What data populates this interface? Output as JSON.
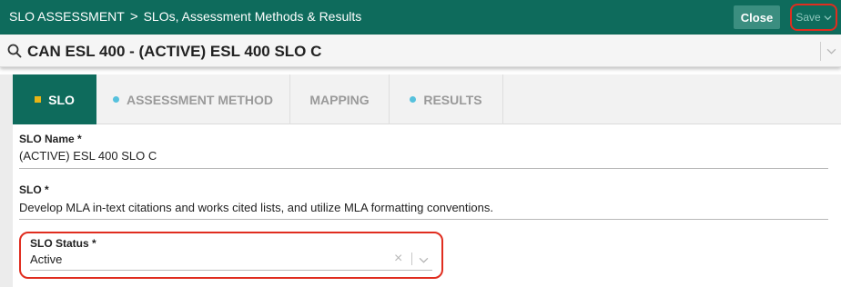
{
  "header": {
    "crumb_root": "SLO ASSESSMENT",
    "crumb_separator": ">",
    "crumb_page": "SLOs, Assessment Methods & Results",
    "close_label": "Close",
    "save_label": "Save"
  },
  "record": {
    "title": "CAN ESL 400 -  (ACTIVE) ESL 400 SLO C"
  },
  "tabs": [
    {
      "label": "SLO",
      "active": true,
      "indicator": "square",
      "indicator_color": "#e7b416"
    },
    {
      "label": "ASSESSMENT METHOD",
      "active": false,
      "indicator": "dot",
      "indicator_color": "#56c1dd"
    },
    {
      "label": "MAPPING",
      "active": false,
      "indicator": "none"
    },
    {
      "label": "RESULTS",
      "active": false,
      "indicator": "dot",
      "indicator_color": "#56c1dd"
    }
  ],
  "form": {
    "slo_name_label": "SLO Name *",
    "slo_name_value": "(ACTIVE) ESL 400 SLO C",
    "slo_label": "SLO *",
    "slo_value": "Develop MLA in-text citations and works cited lists, and utilize MLA formatting conventions.",
    "status_label": "SLO Status *",
    "status_value": "Active",
    "status_clear": "×"
  },
  "colors": {
    "brand": "#0e6b5c",
    "highlight": "#e02d1f"
  }
}
